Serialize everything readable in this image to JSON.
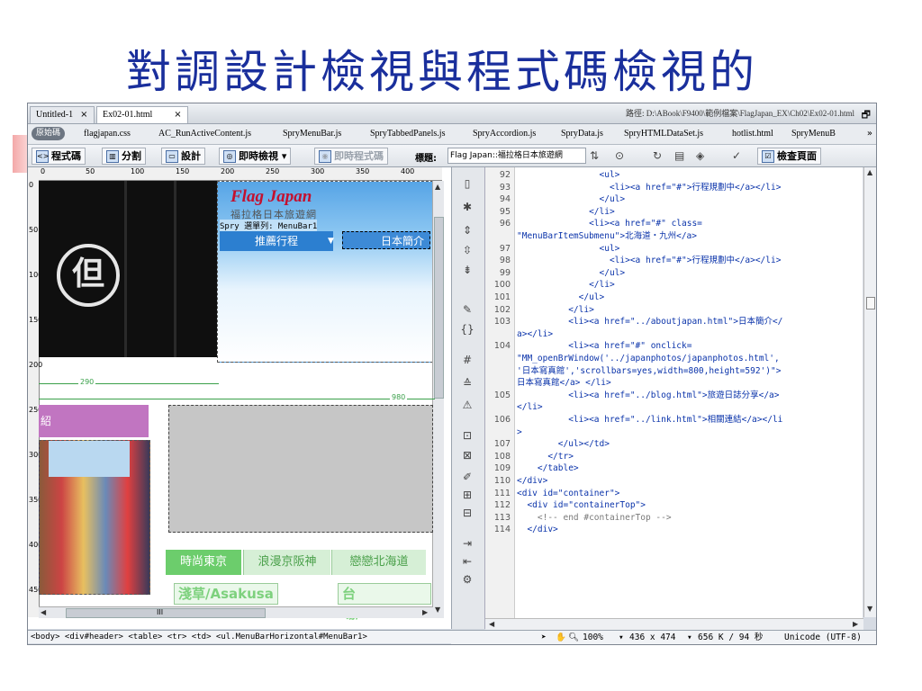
{
  "slide_title": "對調設計檢視與程式碼檢視的",
  "window": {
    "tabs": [
      {
        "label": "Untitled-1",
        "close": "×"
      },
      {
        "label": "Ex02-01.html",
        "close": "×"
      }
    ],
    "path": "路徑: D:\\ABook\\F9400\\範例檔案\\FlagJapan_EX\\Ch02\\Ex02-01.html",
    "restore": "🗗"
  },
  "related_files": {
    "source_code": "原始碼",
    "files": [
      "flagjapan.css",
      "AC_RunActiveContent.js",
      "SpryMenuBar.js",
      "SpryTabbedPanels.js",
      "SpryAccordion.js",
      "SpryData.js",
      "SpryHTMLDataSet.js",
      "hotlist.html",
      "SpryMenuB"
    ],
    "more": "»"
  },
  "toolbar": {
    "code_btn": "程式碼",
    "split_btn": "分割",
    "design_btn": "設計",
    "live_view_btn": "即時檢視",
    "live_code_btn": "即時程式碼",
    "title_label": "標題:",
    "title_value": "Flag Japan::福拉格日本旅遊網",
    "check_page_btn": "檢查頁面"
  },
  "design_view": {
    "ruler_top": [
      "0",
      "50",
      "100",
      "150",
      "200",
      "250",
      "300",
      "350",
      "400"
    ],
    "ruler_left": [
      "0",
      "50",
      "100",
      "150",
      "200",
      "250",
      "300",
      "350",
      "400",
      "450"
    ],
    "curtain_kanji": "但",
    "logo": "Flag Japan",
    "logo_sub": "福拉格日本旅遊網",
    "spry_label": "Spry 選單列: MenuBar1",
    "menu_item_a": "推薦行程",
    "menu_item_b": "日本簡介",
    "guide_290": "290",
    "guide_980": "980",
    "pink_text": "紹",
    "tabs": [
      "時尚東京",
      "浪漫京阪神",
      "戀戀北海道"
    ],
    "subtabs": [
      "淺草/Asakusa",
      "台場/Odaiba"
    ],
    "scroll_marker": "III"
  },
  "tag_selector": "<body> <div#header> <table> <tr> <td> <ul.MenuBarHorizontal#MenuBar1>",
  "code_view": {
    "line_numbers": [
      "92",
      "93",
      "94",
      "95",
      "96",
      "",
      "97",
      "98",
      "99",
      "100",
      "101",
      "102",
      "103",
      "",
      "104",
      "",
      "",
      "",
      "105",
      "",
      "106",
      "",
      "107",
      "108",
      "109",
      "110",
      "111",
      "112",
      "113",
      "114"
    ],
    "lines": [
      "                <ul>",
      "                  <li><a href=\"#\">行程規劃中</a></li>",
      "                </ul>",
      "              </li>",
      "              <li><a href=\"#\" class=",
      "\"MenuBarItemSubmenu\">北海道・九州</a>",
      "                <ul>",
      "                  <li><a href=\"#\">行程規劃中</a></li>",
      "                </ul>",
      "              </li>",
      "            </ul>",
      "          </li>",
      "          <li><a href=\"../aboutjapan.html\">日本簡介</",
      "a></li>",
      "          <li><a href=\"#\" onclick=",
      "\"MM_openBrWindow('../japanphotos/japanphotos.html',",
      "'日本寫真館','scrollbars=yes,width=800,height=592')\">",
      "日本寫真館</a> </li>",
      "          <li><a href=\"../blog.html\">旅遊日誌分享</a>",
      "</li>",
      "          <li><a href=\"../link.html\">相關連結</a></li",
      ">",
      "        </ul></td>",
      "      </tr>",
      "    </table>",
      "</div>",
      "<div id=\"container\">",
      "  <div id=\"containerTop\">",
      "    <!-- end #containerTop -->",
      "  </div>"
    ]
  },
  "status_bar": {
    "zoom": "100%",
    "size": "436 x 474",
    "file_info": "656 K / 94 秒",
    "encoding": "Unicode (UTF-8)"
  }
}
